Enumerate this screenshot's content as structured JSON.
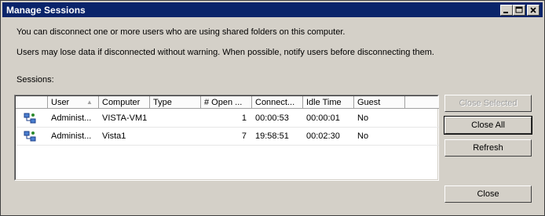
{
  "window": {
    "title": "Manage Sessions"
  },
  "description": {
    "line1": "You can disconnect one or more users who are using shared folders on this computer.",
    "line2": "Users may lose data if disconnected without warning. When possible, notify users before disconnecting them."
  },
  "sessions_label": "Sessions:",
  "table": {
    "columns": [
      "User",
      "Computer",
      "Type",
      "# Open ...",
      "Connect...",
      "Idle Time",
      "Guest"
    ],
    "sort_column": "User",
    "rows": [
      {
        "icon": "network-session-icon",
        "user": "Administ...",
        "computer": "VISTA-VM1",
        "type": "",
        "open": "1",
        "connect": "00:00:53",
        "idle": "00:00:01",
        "guest": "No"
      },
      {
        "icon": "network-session-icon",
        "user": "Administ...",
        "computer": "Vista1",
        "type": "",
        "open": "7",
        "connect": "19:58:51",
        "idle": "00:02:30",
        "guest": "No"
      }
    ]
  },
  "buttons": {
    "close_selected": "Close Selected",
    "close_all": "Close All",
    "refresh": "Refresh",
    "close": "Close"
  },
  "colors": {
    "titlebar": "#0a246a",
    "face": "#d4d0c8"
  }
}
